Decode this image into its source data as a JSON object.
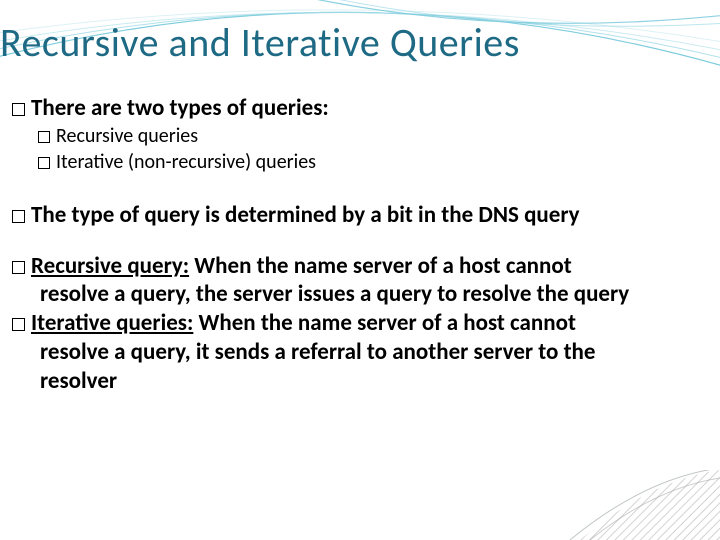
{
  "title": "Recursive and Iterative Queries",
  "b1": "There are two types of queries:",
  "b1a": "Recursive queries",
  "b1b": "Iterative (non-recursive) queries",
  "b2": "The type of query is determined by a bit in the DNS query",
  "b3_label": "Recursive query:",
  "b3_rest": " When the name server of a host cannot",
  "b3_cont": "resolve a query, the server issues a query to resolve the query",
  "b4_label": "Iterative queries:",
  "b4_rest": " When the name server of a host cannot",
  "b4_cont1": "resolve a query, it sends a referral to another server to the",
  "b4_cont2": "resolver"
}
